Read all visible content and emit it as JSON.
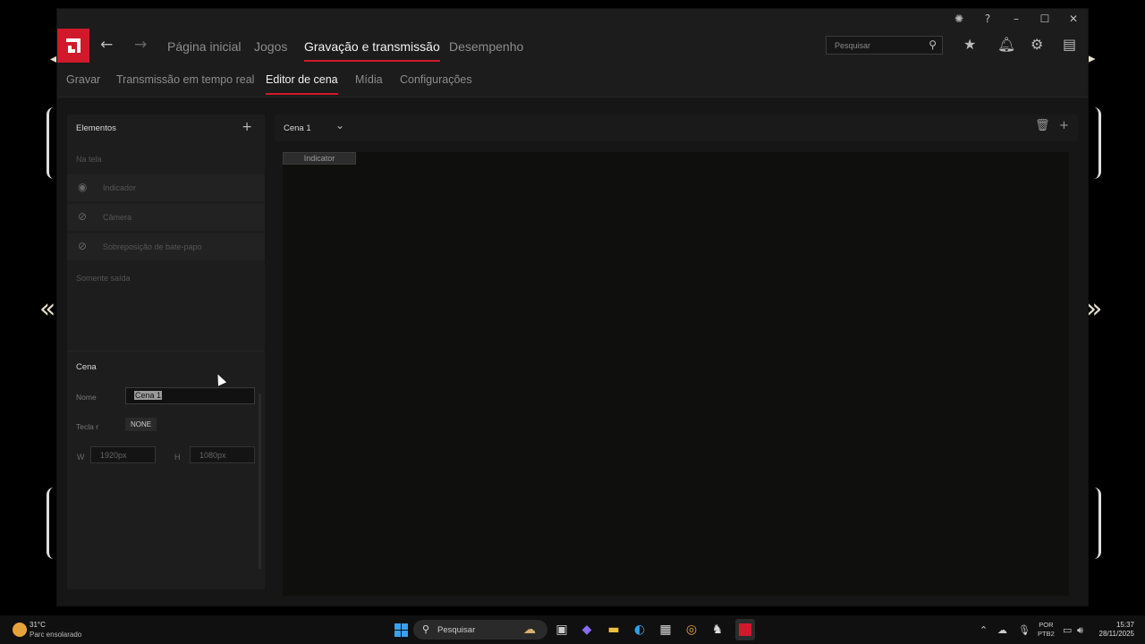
{
  "titlebar": {
    "bug_icon": "bug-icon",
    "help_icon": "help-icon",
    "minimize_icon": "minimize-icon",
    "maximize_icon": "maximize-icon",
    "close_icon": "close-icon"
  },
  "nav": {
    "tabs": [
      {
        "label": "Página inicial",
        "active": false
      },
      {
        "label": "Jogos",
        "active": false
      },
      {
        "label": "Gravação e transmissão",
        "active": true
      },
      {
        "label": "Desempenho",
        "active": false
      }
    ],
    "search_placeholder": "Pesquisar"
  },
  "subnav": {
    "tabs": [
      {
        "label": "Gravar",
        "active": false
      },
      {
        "label": "Transmissão em tempo real",
        "active": false
      },
      {
        "label": "Editor de cena",
        "active": true
      },
      {
        "label": "Mídia",
        "active": false
      },
      {
        "label": "Configurações",
        "active": false
      }
    ]
  },
  "elements_panel": {
    "title": "Elementos",
    "on_screen_label": "Na tela",
    "items": [
      {
        "label": "Indicador",
        "icon": "eye-icon"
      },
      {
        "label": "Câmera",
        "icon": "eye-off-icon"
      },
      {
        "label": "Sobreposição de bate-papo",
        "icon": "eye-off-icon"
      }
    ],
    "output_only_label": "Somente saída"
  },
  "scene_panel": {
    "title": "Cena",
    "name_label": "Nome",
    "name_value": "Cena 1",
    "hotkey_label": "Tecla r",
    "hotkey_value": "NONE",
    "width_label": "W",
    "width_value": "1920px",
    "height_label": "H",
    "height_value": "1080px"
  },
  "canvas": {
    "scene_name": "Cena 1",
    "indicator_label": "Indicator"
  },
  "taskbar": {
    "temperature": "31°C",
    "condition": "Parc ensolarado",
    "search_placeholder": "Pesquisar",
    "lang_top": "POR",
    "lang_bottom": "PTB2",
    "time": "15:37",
    "date": "28/11/2025"
  },
  "colors": {
    "accent": "#d0192a",
    "window_bg": "#1c1c1c",
    "content_bg": "#161616"
  }
}
